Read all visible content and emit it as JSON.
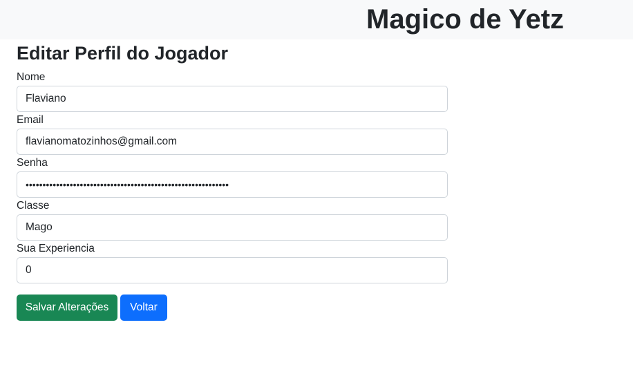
{
  "header": {
    "brand": "Magico de Yetz"
  },
  "form": {
    "title": "Editar Perfil do Jogador",
    "fields": [
      {
        "label": "Nome",
        "value": "Flaviano",
        "type": "text"
      },
      {
        "label": "Email",
        "value": "flavianomatozinhos@gmail.com",
        "type": "email"
      },
      {
        "label": "Senha",
        "value": "••••••••••••••••••••••••••••••••••••••••••••••••••••••••••••",
        "type": "password"
      },
      {
        "label": "Classe",
        "value": "Mago",
        "type": "text"
      },
      {
        "label": "Sua Experiencia",
        "value": "0",
        "type": "number"
      }
    ],
    "save_label": "Salvar Alterações",
    "back_label": "Voltar"
  },
  "colors": {
    "navbar_bg": "#f8f9fa",
    "save_button": "#198754",
    "back_button": "#0d6efd"
  }
}
